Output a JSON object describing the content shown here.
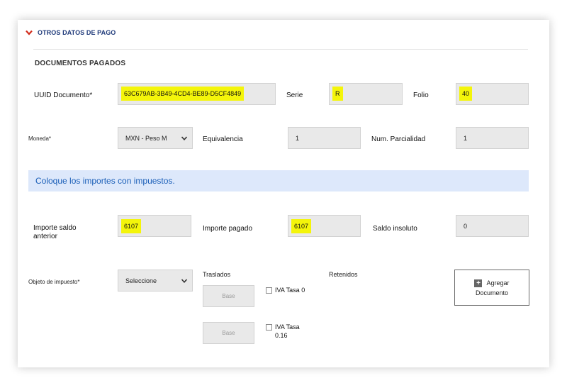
{
  "section": {
    "title": "OTROS DATOS DE PAGO"
  },
  "subsection": {
    "title": "DOCUMENTOS PAGADOS"
  },
  "fields": {
    "uuid": {
      "label": "UUID Documento*",
      "value": "63C679AB-3B49-4CD4-BE89-D5CF4849"
    },
    "serie": {
      "label": "Serie",
      "value": "R"
    },
    "folio": {
      "label": "Folio",
      "value": "40"
    },
    "moneda": {
      "label": "Moneda*",
      "selected": "MXN - Peso M"
    },
    "equivalencia": {
      "label": "Equivalencia",
      "value": "1"
    },
    "parcialidad": {
      "label": "Num. Parcialidad",
      "value": "1"
    },
    "importe_saldo_anterior": {
      "label_line1": "Importe saldo",
      "label_line2": "anterior",
      "value": "6107"
    },
    "importe_pagado": {
      "label": "Importe pagado",
      "value": "6107"
    },
    "saldo_insoluto": {
      "label": "Saldo insoluto",
      "value": "0"
    },
    "objeto_impuesto": {
      "label": "Objeto de impuesto*",
      "selected": "Seleccione"
    }
  },
  "info": {
    "text": "Coloque los importes con impuestos."
  },
  "taxes": {
    "trasladados_label": "Traslados",
    "retenidos_label": "Retenidos",
    "base_placeholder_1": "Base",
    "base_placeholder_2": "Base",
    "iva0_label": "IVA Tasa 0",
    "iva016_line1": "IVA Tasa",
    "iva016_line2": "0.16"
  },
  "add_button": {
    "line1": "Agregar",
    "line2": "Documento"
  },
  "colors": {
    "accent": "#1f3a7a",
    "chevron": "#d12a1a",
    "highlight": "#f4f50a",
    "info_bg": "#dde8fb",
    "info_text": "#1b5fb8"
  }
}
